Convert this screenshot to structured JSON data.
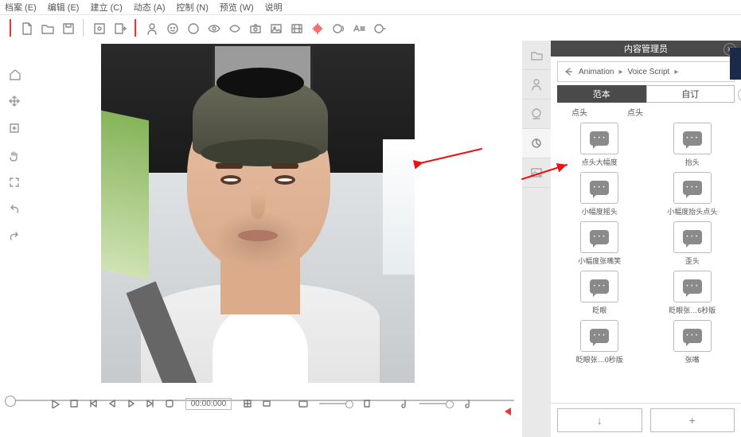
{
  "menu": {
    "items": [
      "档案 (E)",
      "编辑 (E)",
      "建立 (C)",
      "动态 (A)",
      "控制 (N)",
      "预览 (W)",
      "说明"
    ]
  },
  "panel": {
    "title": "内容管理员",
    "breadcrumb": {
      "root": "Animation",
      "child": "Voice Script"
    },
    "tabs": {
      "a": "范本",
      "b": "自订"
    },
    "categories": {
      "a": "点头",
      "b": "点头"
    },
    "tiles": [
      {
        "label": "点头大幅度"
      },
      {
        "label": "抬头"
      },
      {
        "label": "小幅度摇头"
      },
      {
        "label": "小幅度抬头点头"
      },
      {
        "label": "小幅度张嘴笑"
      },
      {
        "label": "歪头"
      },
      {
        "label": "眨眼"
      },
      {
        "label": "眨眼张…6秒版"
      },
      {
        "label": "眨眼张…0秒版"
      },
      {
        "label": "张嘴"
      }
    ],
    "foot": {
      "down": "↓",
      "plus": "+"
    }
  },
  "transport": {
    "timecode": "00:00:000"
  }
}
